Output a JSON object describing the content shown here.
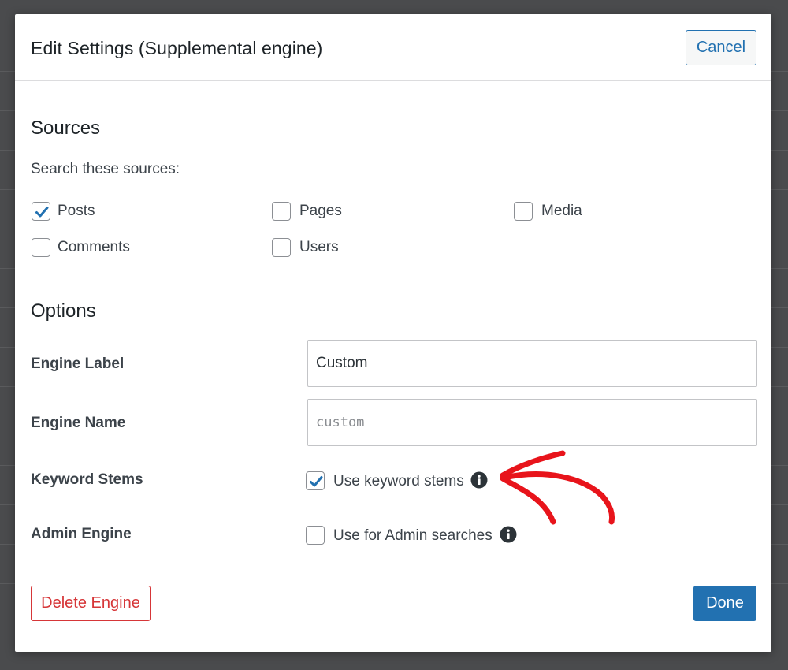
{
  "dialog": {
    "title": "Edit Settings (Supplemental engine)",
    "cancel_label": "Cancel"
  },
  "sources": {
    "heading": "Sources",
    "prompt": "Search these sources:",
    "items": [
      {
        "label": "Posts",
        "checked": true
      },
      {
        "label": "Pages",
        "checked": false
      },
      {
        "label": "Media",
        "checked": false
      },
      {
        "label": "Comments",
        "checked": false
      },
      {
        "label": "Users",
        "checked": false
      }
    ]
  },
  "options": {
    "heading": "Options",
    "engine_label": {
      "label": "Engine Label",
      "value": "Custom"
    },
    "engine_name": {
      "label": "Engine Name",
      "value": "custom"
    },
    "keyword_stems": {
      "label": "Keyword Stems",
      "option": "Use keyword stems",
      "checked": true
    },
    "admin_engine": {
      "label": "Admin Engine",
      "option": "Use for Admin searches",
      "checked": false
    }
  },
  "footer": {
    "delete_label": "Delete Engine",
    "done_label": "Done"
  },
  "colors": {
    "accent": "#2271b1",
    "danger": "#d63638",
    "annotation_arrow": "#e8141b"
  },
  "icons": {
    "checkmark": "checkmark-icon",
    "info": "info-icon",
    "annotation": "red-arrow-annotation"
  }
}
